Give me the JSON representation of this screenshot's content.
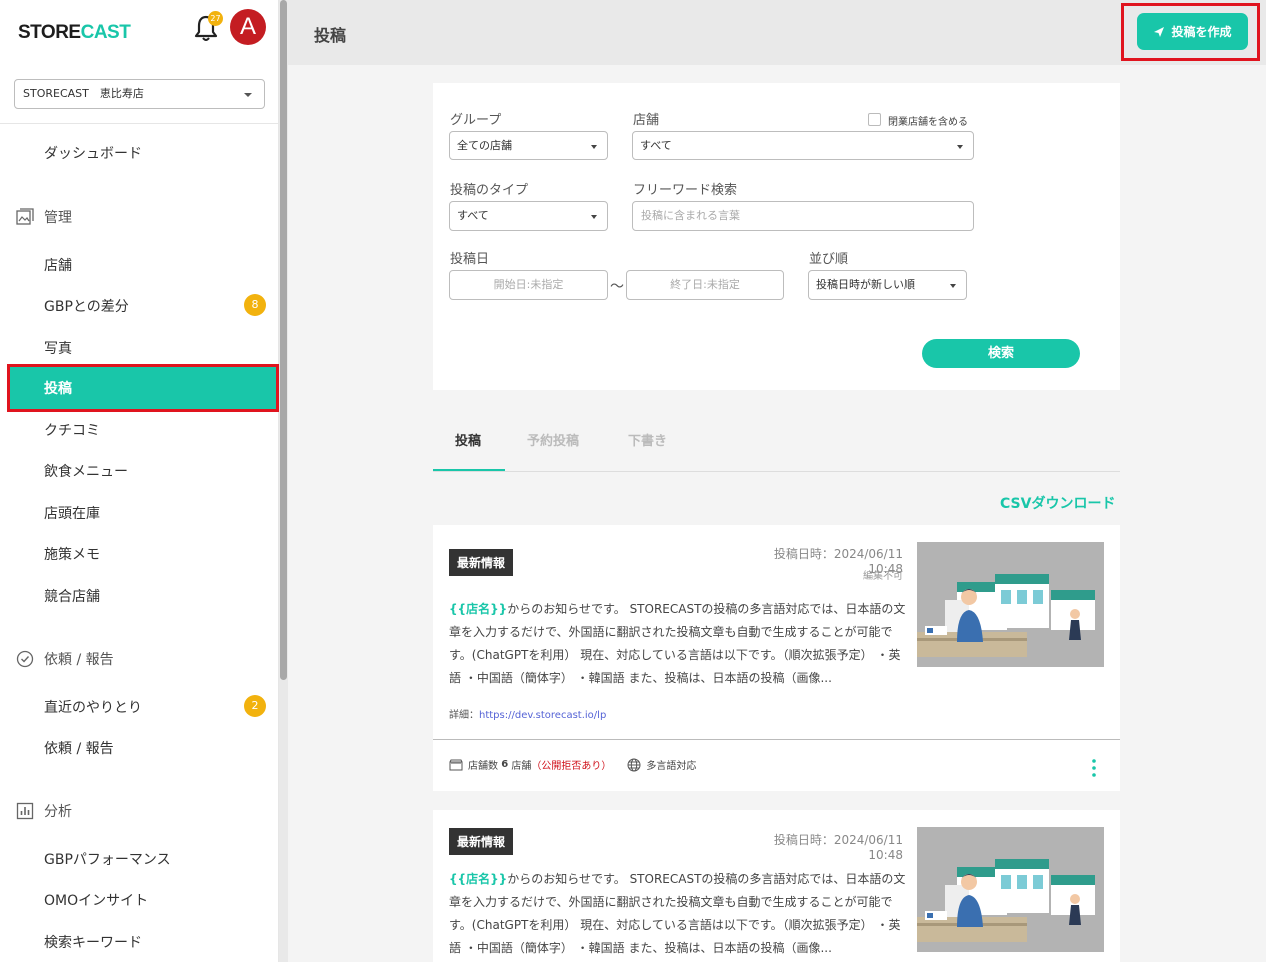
{
  "sidebar": {
    "logo_a": "STORE",
    "logo_b": "CAST",
    "notification_count": "27",
    "avatar_letter": "A",
    "store_selector": "STORECAST　恵比寿店",
    "items": {
      "dashboard": "ダッシュボード",
      "manage": "管理",
      "stores": "店舗",
      "gbp_diff": "GBPとの差分",
      "gbp_diff_badge": "8",
      "photos": "写真",
      "posts": "投稿",
      "reviews": "クチコミ",
      "menu": "飲食メニュー",
      "inventory": "店頭在庫",
      "memo": "施策メモ",
      "competitors": "競合店舗",
      "requests": "依頼 / 報告",
      "recent": "直近のやりとり",
      "recent_badge": "2",
      "requests_sub": "依頼 / 報告",
      "analysis": "分析",
      "gbp_perf": "GBPパフォーマンス",
      "omo": "OMOインサイト",
      "keywords": "検索キーワード"
    }
  },
  "header": {
    "title": "投稿",
    "create_button": "投稿を作成"
  },
  "filter": {
    "group_label": "グループ",
    "group_value": "全ての店舗",
    "store_label": "店舗",
    "store_value": "すべて",
    "include_closed": "閉業店舗を含める",
    "type_label": "投稿のタイプ",
    "type_value": "すべて",
    "keyword_label": "フリーワード検索",
    "keyword_placeholder": "投稿に含まれる言葉",
    "date_label": "投稿日",
    "start_placeholder": "開始日:未指定",
    "tilde": "〜",
    "end_placeholder": "終了日:未指定",
    "sort_label": "並び順",
    "sort_value": "投稿日時が新しい順",
    "search_button": "検索"
  },
  "tabs": [
    "投稿",
    "予約投稿",
    "下書き"
  ],
  "csv_download": "CSVダウンロード",
  "posts": [
    {
      "tag": "最新情報",
      "date": "投稿日時：2024/06/11 10:48",
      "edit_status": "編集不可",
      "var": "{{店名}}",
      "text": "からのお知らせです。 STORECASTの投稿の多言語対応では、日本語の文章を入力するだけで、外国語に翻訳された投稿文章も自動で生成することが可能です。(ChatGPTを利用） 現在、対応している言語は以下です。（順次拡張予定） ・英語 ・中国語（簡体字） ・韓国語 また、投稿は、日本語の投稿（画像...",
      "detail_label": "詳細：",
      "detail_link": "https://dev.storecast.io/lp",
      "store_count_label": "店舗数",
      "store_count": "6",
      "store_unit": "店舗",
      "rejected": "（公開拒否あり）",
      "multilang": "多言語対応"
    },
    {
      "tag": "最新情報",
      "date": "投稿日時：2024/06/11 10:48",
      "var": "{{店名}}",
      "text": "からのお知らせです。 STORECASTの投稿の多言語対応では、日本語の文章を入力するだけで、外国語に翻訳された投稿文章も自動で生成することが可能です。(ChatGPTを利用） 現在、対応している言語は以下です。（順次拡張予定） ・英語 ・中国語（簡体字） ・韓国語 また、投稿は、日本語の投稿（画像..."
    }
  ],
  "colors": {
    "accent": "#19c6a9",
    "highlight": "#e0141e",
    "badge": "#f2b20e",
    "avatar": "#c41d22"
  }
}
